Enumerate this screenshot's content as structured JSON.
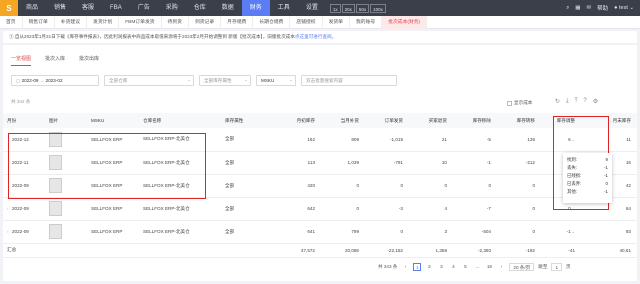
{
  "topnav": {
    "logo": "S",
    "items": [
      "商品",
      "销售",
      "客服",
      "FBA",
      "广告",
      "采购",
      "仓库",
      "数据",
      "财务",
      "工具",
      "设置"
    ],
    "active_index": 8,
    "zoom": [
      "1x",
      "20x",
      "50x",
      "100x"
    ],
    "search_icon": "search-icon",
    "grid_icon": "grid-icon",
    "mail_icon": "mail-icon",
    "help": "帮助",
    "user": "test"
  },
  "tabs": [
    "首页",
    "销售订单",
    "补货建议",
    "发货计划",
    "FBM订单发货",
    "待到货",
    "到货记录",
    "月存储费",
    "长期仓储费",
    "店铺授权",
    "发货单",
    "我的账号",
    "批次成本(财务)"
  ],
  "active_tab_index": 12,
  "notice": {
    "prefix": "① 自从2023年1月31日下载《库存事件报表》，因此利润报表中商品成本取值来源将于2023年2月开始调整到 新版【批次成本】，旧版批次成本",
    "link": "点这里可进行查阅。"
  },
  "subtabs": [
    "一览视图",
    "批次入库",
    "批次出库"
  ],
  "active_subtab": 0,
  "filters": {
    "date_start": "2022-09",
    "date_sep": "→",
    "date_end": "2023-02",
    "warehouse_placeholder": "全部仓库",
    "attribute_placeholder": "全部库存属性",
    "search_type": "MSKU",
    "search_placeholder": "双击批量搜索内容"
  },
  "count_label": "共 342 条",
  "show_cost_label": "显示成本",
  "columns": [
    "月份",
    "图片",
    "MSKU",
    "仓库名称",
    "库存属性",
    "月初库存",
    "当月补货",
    "订单发货",
    "买家退货",
    "库存移除",
    "库存转移",
    "库存调整",
    "月末库存"
  ],
  "rows": [
    {
      "expand": "",
      "month": "2022-12",
      "msku": "SELLFOX ERP",
      "warehouse": "SELLFOX ERP-北美仓",
      "attr": "全部",
      "v": [
        "162",
        "809",
        "-1,015",
        "21",
        "-5",
        "136",
        "6",
        "11"
      ]
    },
    {
      "expand": "",
      "month": "2022-11",
      "msku": "SELLFOX ERP",
      "warehouse": "SELLFOX ERP-北美仓",
      "attr": "全部",
      "v": [
        "113",
        "1,039",
        "-791",
        "10",
        "-1",
        "-212",
        "4",
        "16"
      ]
    },
    {
      "expand": "",
      "month": "2022-09",
      "msku": "SELLFOX ERP",
      "warehouse": "SELLFOX ERP-北美仓",
      "attr": "全部",
      "v": [
        "420",
        "0",
        "0",
        "0",
        "0",
        "0",
        "0",
        "42"
      ]
    },
    {
      "expand": "›",
      "month": "2022-09",
      "msku": "SELLFOX ERP",
      "warehouse": "SELLFOX ERP-北美仓",
      "attr": "全部",
      "v": [
        "642",
        "0",
        "-3",
        "4",
        "-7",
        "0",
        "0",
        "64"
      ]
    },
    {
      "expand": "›",
      "month": "2022-09",
      "msku": "SELLFOX ERP",
      "warehouse": "SELLFOX ERP-北美仓",
      "attr": "全部",
      "v": [
        "641",
        "799",
        "0",
        "3",
        "-504",
        "0",
        "-1",
        "93"
      ]
    }
  ],
  "totals": {
    "label": "汇总",
    "v": [
      "47,572",
      "20,086",
      "-22,152",
      "1,358",
      "-2,360",
      "-192",
      "-41",
      "40,61"
    ]
  },
  "pager": {
    "total": "共 343 条",
    "pages": [
      "1",
      "2",
      "3",
      "4",
      "5",
      "...",
      "18"
    ],
    "active": "1",
    "page_size": "20 条/页",
    "goto_label": "跳至",
    "goto_value": "1",
    "page_suffix": "页",
    "prev": "‹",
    "next": "›"
  },
  "popup": {
    "rows": [
      {
        "k": "找到:",
        "v": "9"
      },
      {
        "k": "丢失:",
        "v": "-1"
      },
      {
        "k": "已残损:",
        "v": "-1"
      },
      {
        "k": "已丢弃:",
        "v": "0"
      },
      {
        "k": "其他:",
        "v": "-1"
      }
    ]
  },
  "colors": {
    "nav_bg": "#3a3f4a",
    "accent": "#5b7cf5",
    "tab_active": "#e0454f",
    "highlight": "#e02424"
  }
}
